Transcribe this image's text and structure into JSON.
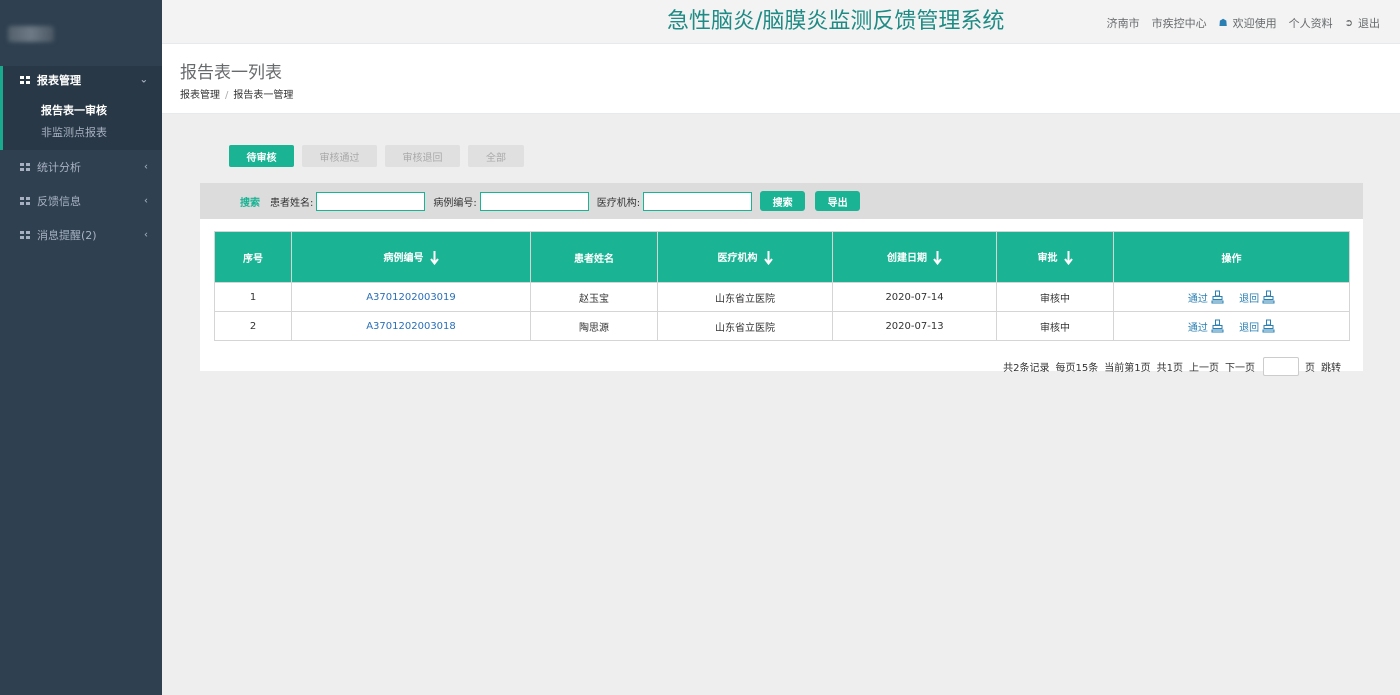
{
  "header": {
    "system_title": "急性脑炎/脑膜炎监测反馈管理系统",
    "city": "济南市",
    "org": "市疾控中心",
    "welcome": "欢迎使用",
    "profile": "个人资料",
    "logout": "退出"
  },
  "sidebar": {
    "items": [
      {
        "label": "报表管理",
        "expanded": true,
        "children": [
          {
            "label": "报告表一审核",
            "active": true
          },
          {
            "label": "非监测点报表"
          }
        ]
      },
      {
        "label": "统计分析"
      },
      {
        "label": "反馈信息"
      },
      {
        "label": "消息提醒(2)"
      }
    ]
  },
  "page": {
    "title": "报告表一列表",
    "breadcrumb": [
      "报表管理",
      "报告表一管理"
    ]
  },
  "tabs": [
    "待审核",
    "审核通过",
    "审核退回",
    "全部"
  ],
  "search": {
    "label": "搜索",
    "fields": [
      "患者姓名:",
      "病例编号:",
      "医疗机构:"
    ],
    "search_button": "搜索",
    "export_button": "导出"
  },
  "table": {
    "columns": [
      "序号",
      "病例编号",
      "患者姓名",
      "医疗机构",
      "创建日期",
      "审批",
      "操作"
    ],
    "rows": [
      {
        "index": "1",
        "case_no": "A3701202003019",
        "name": "赵玉宝",
        "org": "山东省立医院",
        "date": "2020-07-14",
        "status": "审核中",
        "approve": "通过",
        "reject": "退回"
      },
      {
        "index": "2",
        "case_no": "A3701202003018",
        "name": "陶思源",
        "org": "山东省立医院",
        "date": "2020-07-13",
        "status": "审核中",
        "approve": "通过",
        "reject": "退回"
      }
    ]
  },
  "pager": {
    "total": "共2条记录",
    "per_page": "每页15条",
    "current": "当前第1页",
    "pages": "共1页",
    "prev": "上一页",
    "next": "下一页",
    "page_unit": "页",
    "jump": "跳转"
  },
  "colors": {
    "accent": "#1ab394",
    "sidebar": "#2f4050",
    "title": "#1f8b84",
    "link": "#2a6fb8"
  }
}
